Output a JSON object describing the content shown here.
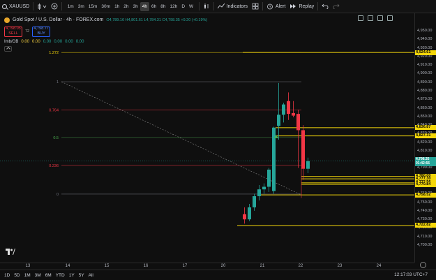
{
  "toolbar": {
    "symbol": "XAUUSD",
    "timeframes": [
      "1m",
      "3m",
      "15m",
      "30m",
      "1h",
      "2h",
      "3h",
      "4h",
      "6h",
      "8h",
      "12h",
      "D",
      "W"
    ],
    "active_timeframe": "4h",
    "indicators_label": "Indicators",
    "alert_label": "Alert",
    "replay_label": "Replay"
  },
  "legend": {
    "title": "Gold Spot / U.S. Dollar · 4h · FOREX.com",
    "ohlc": "O4,789.16 H4,801.61 L4,784.31 C4,798.35 +9.20 (+0.19%)",
    "sell_price": "4,798.05",
    "sell_label": "SELL",
    "spread": "72",
    "buy_price": "4,798.77",
    "buy_label": "BUY",
    "indicator_name": "Imb/OB",
    "indicator_values": [
      "0.00",
      "0.00",
      "0.00",
      "0.00",
      "0.00",
      "0.00"
    ]
  },
  "price_axis": {
    "ticks": [
      "4,950.00",
      "4,940.00",
      "4,930.00",
      "4,920.00",
      "4,910.00",
      "4,900.00",
      "4,890.00",
      "4,880.00",
      "4,870.00",
      "4,860.00",
      "4,850.00",
      "4,840.00",
      "4,830.00",
      "4,820.00",
      "4,810.00",
      "4,800.00",
      "4,790.00",
      "4,780.00",
      "4,770.00",
      "4,760.00",
      "4,750.00",
      "4,740.00",
      "4,730.00",
      "4,720.00",
      "4,710.00",
      "4,700.00"
    ],
    "labels": [
      {
        "text": "4,924.61",
        "kind": "level"
      },
      {
        "text": "4,836.87",
        "kind": "level"
      },
      {
        "text": "4,827.31",
        "kind": "level"
      },
      {
        "text": "4,798.35",
        "sub": "01:42:56",
        "kind": "current"
      },
      {
        "text": "4,780.00",
        "kind": "level"
      },
      {
        "text": "4,777.30",
        "kind": "level"
      },
      {
        "text": "4,772.56",
        "kind": "level"
      },
      {
        "text": "4,770.84",
        "kind": "level"
      },
      {
        "text": "4,758.52",
        "kind": "level"
      },
      {
        "text": "4,722.82",
        "kind": "level"
      }
    ]
  },
  "fib_labels": [
    "1.272",
    "1",
    "0.764",
    "0.5",
    "0.236",
    "0"
  ],
  "time_axis": [
    "13",
    "14",
    "15",
    "16",
    "17",
    "20",
    "21",
    "22",
    "23",
    "24"
  ],
  "range_buttons": [
    "1D",
    "5D",
    "1M",
    "3M",
    "6M",
    "YTD",
    "1Y",
    "5Y",
    "All"
  ],
  "clock": "12:17:03 UTC+7",
  "chart_data": {
    "type": "candlestick",
    "y_range": [
      4700,
      4950
    ],
    "candles": [
      {
        "o": 4736,
        "h": 4744,
        "l": 4725,
        "c": 4730
      },
      {
        "o": 4730,
        "h": 4748,
        "l": 4728,
        "c": 4744
      },
      {
        "o": 4744,
        "h": 4760,
        "l": 4740,
        "c": 4757
      },
      {
        "o": 4757,
        "h": 4770,
        "l": 4752,
        "c": 4765
      },
      {
        "o": 4765,
        "h": 4772,
        "l": 4760,
        "c": 4768
      },
      {
        "o": 4768,
        "h": 4790,
        "l": 4762,
        "c": 4788
      },
      {
        "o": 4763,
        "h": 4838,
        "l": 4760,
        "c": 4837
      },
      {
        "o": 4839,
        "h": 4889,
        "l": 4823,
        "c": 4852
      },
      {
        "o": 4852,
        "h": 4866,
        "l": 4843,
        "c": 4864
      },
      {
        "o": 4868,
        "h": 4878,
        "l": 4846,
        "c": 4853
      },
      {
        "o": 4854,
        "h": 4868,
        "l": 4849,
        "c": 4851
      },
      {
        "o": 4853,
        "h": 4858,
        "l": 4790,
        "c": 4834
      },
      {
        "o": 4834,
        "h": 4840,
        "l": 4776,
        "c": 4789
      },
      {
        "o": 4789,
        "h": 4802,
        "l": 4784,
        "c": 4798
      }
    ]
  }
}
